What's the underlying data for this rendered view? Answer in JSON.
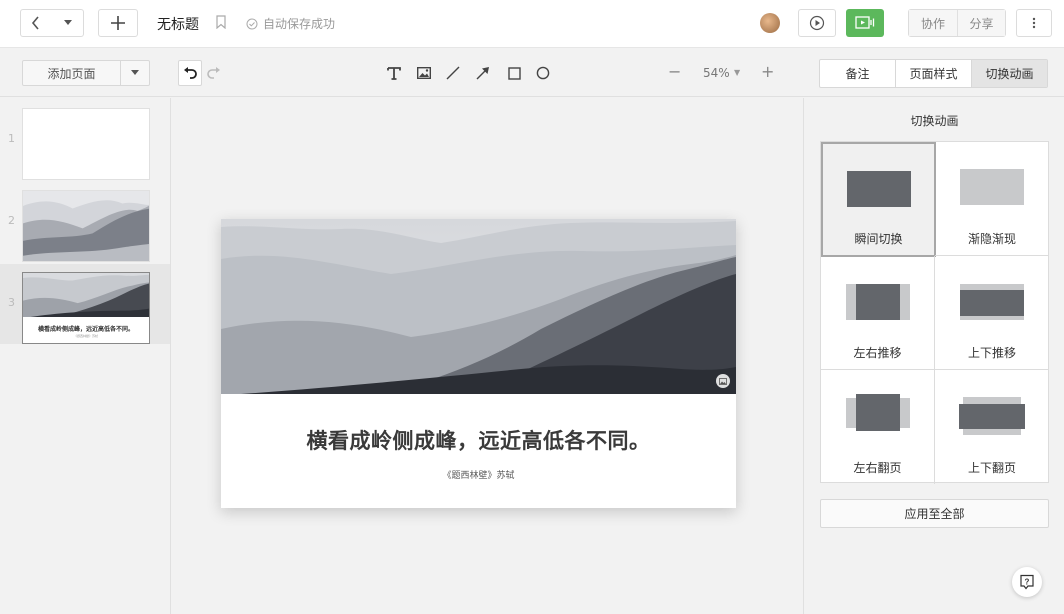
{
  "header": {
    "title": "无标题",
    "save_status": "自动保存成功",
    "collab_label": "协作",
    "share_label": "分享"
  },
  "toolbar": {
    "add_page_label": "添加页面",
    "zoom": "54%"
  },
  "right_tabs": [
    {
      "label": "备注"
    },
    {
      "label": "页面样式"
    },
    {
      "label": "切换动画",
      "active": true
    }
  ],
  "thumbnails": [
    {
      "number": "1"
    },
    {
      "number": "2"
    },
    {
      "number": "3",
      "caption": "横看成岭侧成峰，远近高低各不同。",
      "sub": "《题西林壁》苏轼"
    }
  ],
  "slide": {
    "title": "横看成岭侧成峰，远近高低各不同。",
    "subtitle": "《题西林壁》苏轼"
  },
  "panel": {
    "title": "切换动画",
    "animations": [
      {
        "label": "瞬间切换",
        "selected": true
      },
      {
        "label": "渐隐渐现"
      },
      {
        "label": "左右推移"
      },
      {
        "label": "上下推移"
      },
      {
        "label": "左右翻页"
      },
      {
        "label": "上下翻页"
      }
    ],
    "apply_label": "应用至全部"
  },
  "icons": {
    "back": "chevron-left-icon",
    "dropdown": "caret-down-icon",
    "add": "plus-icon",
    "bookmark": "bookmark-icon",
    "saved": "check-circle-icon",
    "play": "play-icon",
    "present": "present-icon",
    "more": "more-vertical-icon",
    "undo": "undo-icon",
    "redo": "redo-icon",
    "text": "text-icon",
    "image": "image-icon",
    "line": "line-icon",
    "arrow": "arrow-icon",
    "rectangle": "rectangle-icon",
    "circle": "circle-icon",
    "help": "help-icon"
  },
  "colors": {
    "present_green": "#5cb85c",
    "mountain_dark": "#2e3138",
    "anim_shape": "#63666b",
    "anim_shape_light": "#c8c9cb"
  }
}
